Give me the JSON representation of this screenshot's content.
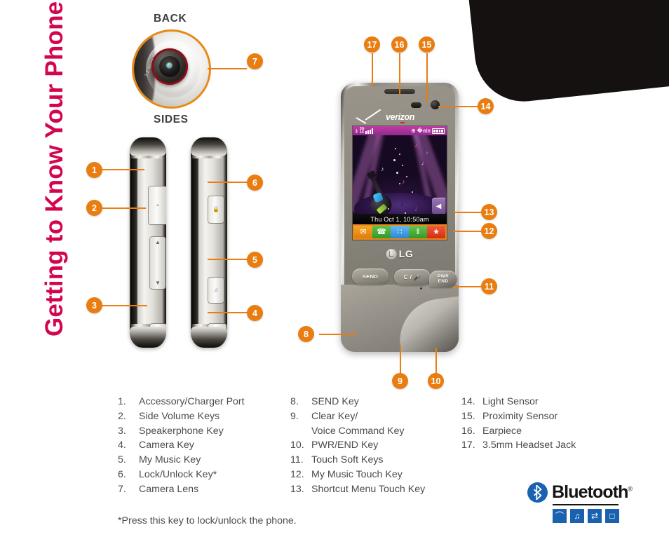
{
  "page_title": "Getting to Know Your Phone",
  "sections": {
    "back_caption": "BACK",
    "sides_caption": "SIDES",
    "camera_mp_text": "3.2 Mega Pixels"
  },
  "callouts": [
    {
      "num": "1"
    },
    {
      "num": "2"
    },
    {
      "num": "3"
    },
    {
      "num": "4"
    },
    {
      "num": "5"
    },
    {
      "num": "6"
    },
    {
      "num": "7"
    },
    {
      "num": "8"
    },
    {
      "num": "9"
    },
    {
      "num": "10"
    },
    {
      "num": "11"
    },
    {
      "num": "12"
    },
    {
      "num": "13"
    },
    {
      "num": "14"
    },
    {
      "num": "15"
    },
    {
      "num": "16"
    },
    {
      "num": "17"
    }
  ],
  "phone": {
    "brand_carrier": "verizon",
    "brand_maker": "LG",
    "keys": {
      "send": "SEND",
      "clear": "C /",
      "pwr_line1": "PWR",
      "pwr_line2": "END"
    },
    "screen": {
      "status": {
        "signal_icon": "signal-icon",
        "net_3g": "3G",
        "net_1x": "1X",
        "gps_icon": "gps-icon",
        "bluetooth_icon": "bluetooth-icon",
        "battery_icon": "battery-icon"
      },
      "datetime": "Thu Oct 1, 10:50am",
      "soft_keys": [
        {
          "name": "messaging",
          "glyph": "✉"
        },
        {
          "name": "recent-calls",
          "glyph": "☎"
        },
        {
          "name": "main-menu",
          "glyph": "∷"
        },
        {
          "name": "contacts-list",
          "glyph": "‖"
        },
        {
          "name": "favorites",
          "glyph": "★"
        }
      ],
      "touch_keys": [
        {
          "name": "shortcut-menu",
          "glyph": "◀"
        },
        {
          "name": "my-music",
          "glyph": "♫"
        }
      ]
    }
  },
  "legend": {
    "col1": [
      {
        "num": "1.",
        "text": "Accessory/Charger Port"
      },
      {
        "num": "2.",
        "text": "Side Volume Keys"
      },
      {
        "num": "3.",
        "text": "Speakerphone Key"
      },
      {
        "num": "4.",
        "text": "Camera Key"
      },
      {
        "num": "5.",
        "text": "My Music Key"
      },
      {
        "num": "6.",
        "text": "Lock/Unlock Key*"
      },
      {
        "num": "7.",
        "text": "Camera Lens"
      }
    ],
    "col2": [
      {
        "num": "8.",
        "text": "SEND Key"
      },
      {
        "num": "9.",
        "text": "Clear Key/",
        "sub": "Voice Command Key"
      },
      {
        "num": "10.",
        "text": "PWR/END Key"
      },
      {
        "num": "11.",
        "text": "Touch Soft Keys"
      },
      {
        "num": "12.",
        "text": "My Music Touch Key"
      },
      {
        "num": "13.",
        "text": "Shortcut Menu Touch Key"
      }
    ],
    "col3": [
      {
        "num": "14.",
        "text": "Light Sensor"
      },
      {
        "num": "15.",
        "text": "Proximity Sensor"
      },
      {
        "num": "16.",
        "text": "Earpiece"
      },
      {
        "num": "17.",
        "text": "3.5mm Headset Jack"
      }
    ],
    "footnote": "*Press this key to lock/unlock the phone."
  },
  "bluetooth": {
    "word": "Bluetooth",
    "registered": "®",
    "profiles": [
      {
        "name": "headset-profile",
        "glyph": "⌒"
      },
      {
        "name": "a2dp-music-profile",
        "glyph": "♫"
      },
      {
        "name": "file-transfer-profile",
        "glyph": "⇄"
      },
      {
        "name": "print-profile",
        "glyph": "□"
      }
    ]
  },
  "colors": {
    "accent_orange": "#E97D11",
    "title_magenta": "#D4054F",
    "bluetooth_blue": "#1A62B0"
  }
}
